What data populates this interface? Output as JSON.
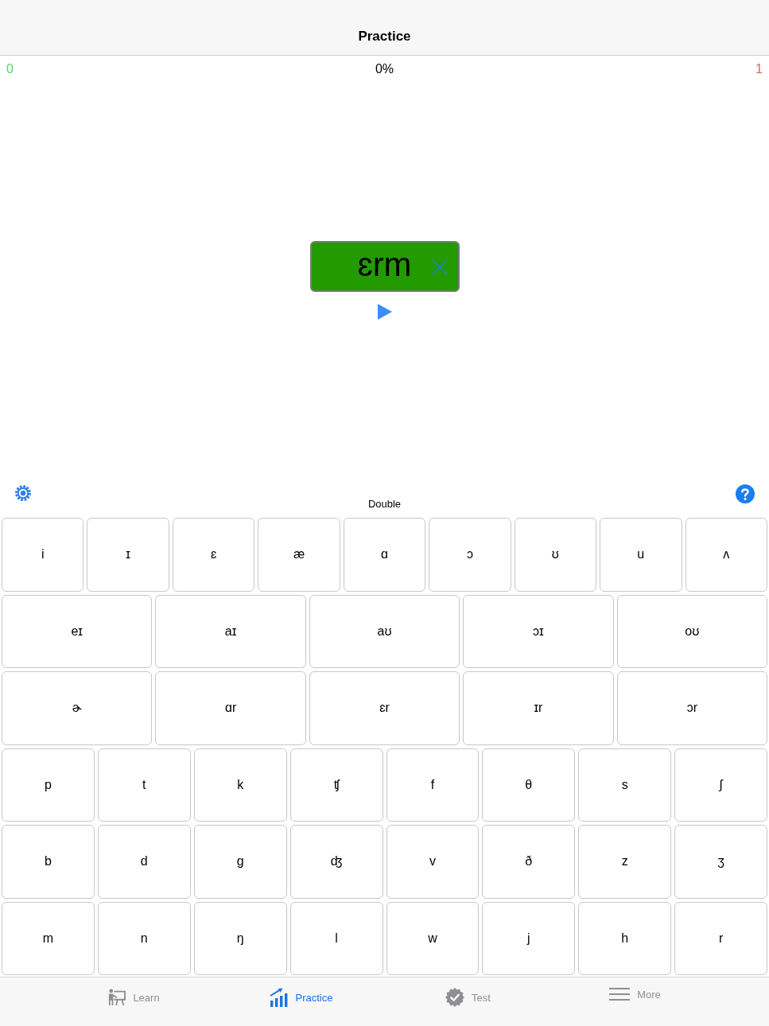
{
  "nav_bar": {
    "title": "Practice"
  },
  "score_bar": {
    "correct_count": "0",
    "progress": "0%",
    "incorrect_count": "1"
  },
  "answer_box": {
    "text": "ɛrm"
  },
  "keyboard_bar": {
    "mode": "Double"
  },
  "keyboard": {
    "rows": [
      {
        "keys": [
          "i",
          "ɪ",
          "ɛ",
          "æ",
          "ɑ",
          "ɔ",
          "ʊ",
          "u",
          "ʌ"
        ]
      },
      {
        "keys": [
          "eɪ",
          "aɪ",
          "aʊ",
          "ɔɪ",
          "oʊ"
        ]
      },
      {
        "keys": [
          "ɚ",
          "ɑr",
          "ɛr",
          "ɪr",
          "ɔr"
        ]
      },
      {
        "keys": [
          "p",
          "t",
          "k",
          "ʧ",
          "f",
          "θ",
          "s",
          "ʃ"
        ]
      },
      {
        "keys": [
          "b",
          "d",
          "g",
          "ʤ",
          "v",
          "ð",
          "z",
          "ʒ"
        ]
      },
      {
        "keys": [
          "m",
          "n",
          "ŋ",
          "l",
          "w",
          "j",
          "h",
          "r"
        ]
      }
    ]
  },
  "tab_bar": {
    "items": [
      {
        "label": "Learn",
        "selected": false
      },
      {
        "label": "Practice",
        "selected": true
      },
      {
        "label": "Test",
        "selected": false
      },
      {
        "label": "More",
        "selected": false
      }
    ]
  }
}
